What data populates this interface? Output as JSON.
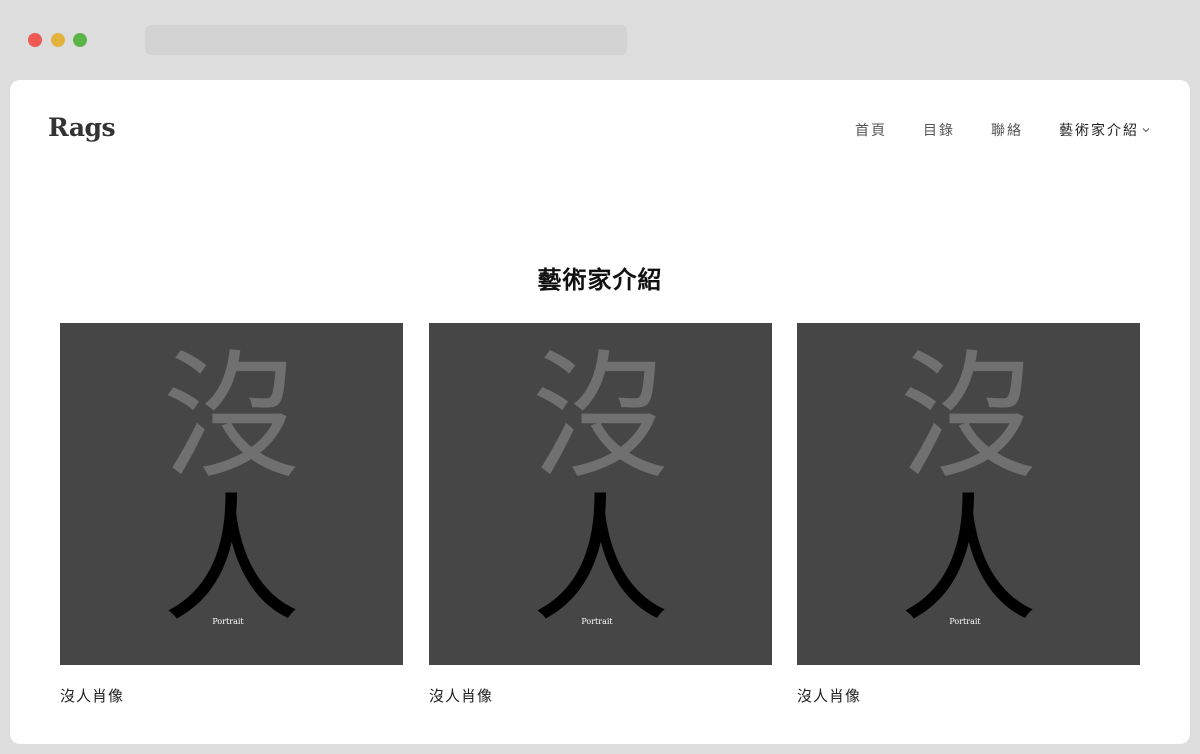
{
  "site": {
    "logo": "Rags"
  },
  "nav": {
    "items": [
      {
        "label": "首頁"
      },
      {
        "label": "目錄"
      },
      {
        "label": "聯絡"
      },
      {
        "label": "藝術家介紹"
      }
    ]
  },
  "main": {
    "title": "藝術家介紹",
    "cards": [
      {
        "glyph_top": "沒",
        "glyph_bottom": "人",
        "subtitle": "Portrait",
        "caption": "沒人肖像"
      },
      {
        "glyph_top": "沒",
        "glyph_bottom": "人",
        "subtitle": "Portrait",
        "caption": "沒人肖像"
      },
      {
        "glyph_top": "沒",
        "glyph_bottom": "人",
        "subtitle": "Portrait",
        "caption": "沒人肖像"
      }
    ]
  },
  "colors": {
    "card_background": "#464646",
    "glyph_top": "#707070",
    "glyph_bottom": "#000000"
  }
}
